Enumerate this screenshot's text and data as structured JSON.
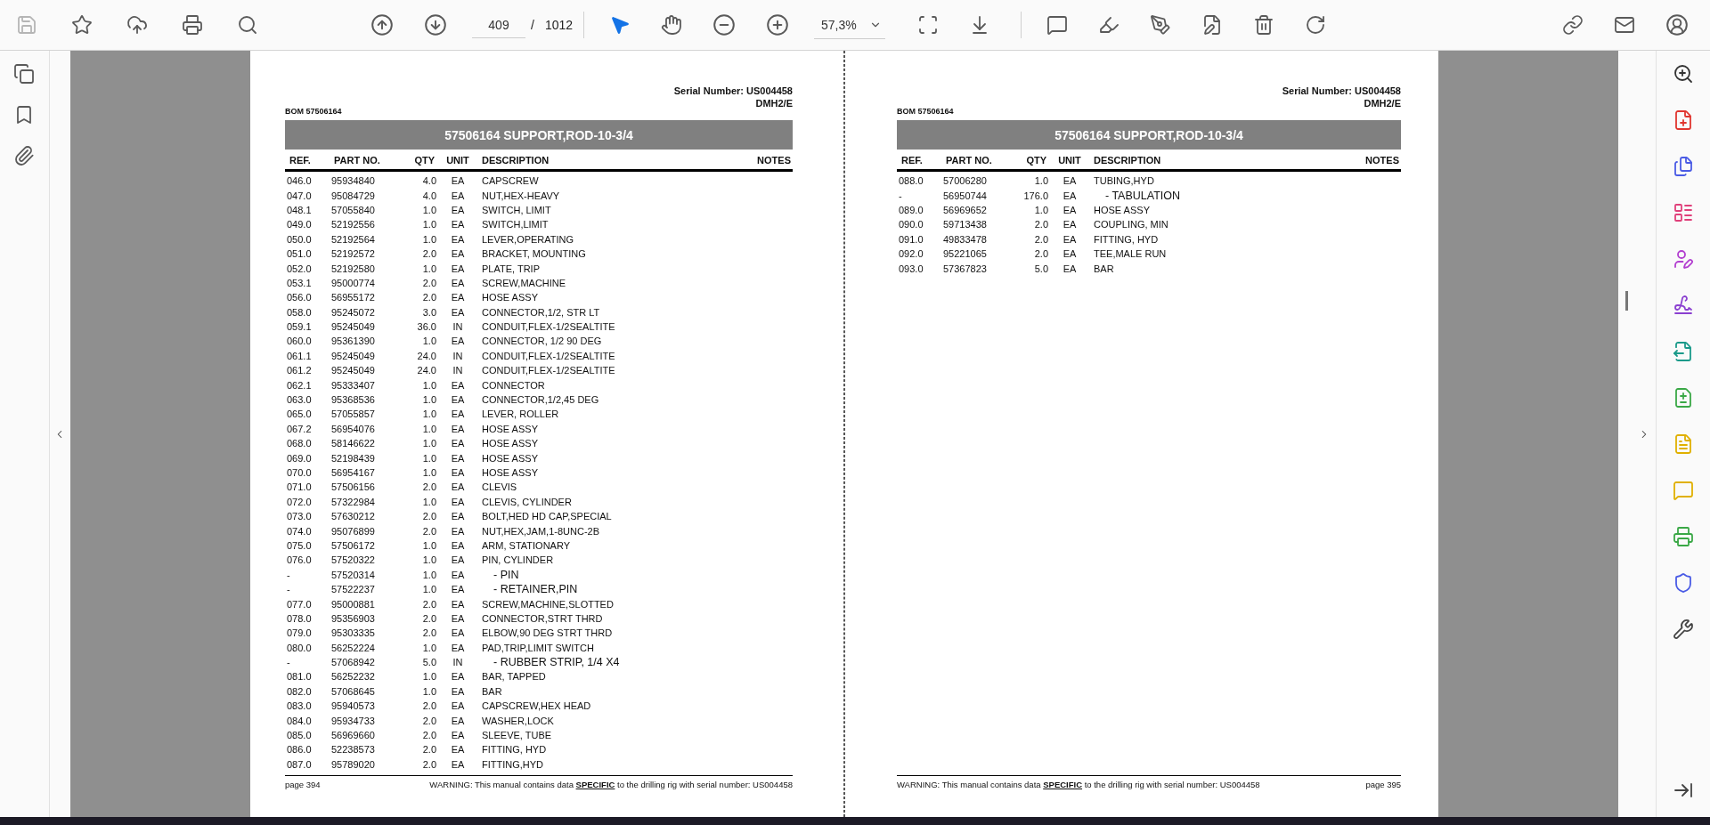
{
  "toolbar": {
    "page_current": "409",
    "page_separator": "/",
    "page_total": "1012",
    "zoom": "57,3%",
    "pointer_tools": [
      {
        "kind": "select",
        "selected": true
      },
      {
        "kind": "hand",
        "selected": false
      }
    ]
  },
  "pages": [
    {
      "kind": "left",
      "serial": "Serial Number: US004458",
      "model": "DMH2/E",
      "bom": "BOM 57506164",
      "title": "57506164 SUPPORT,ROD-10-3/4",
      "columns": [
        "REF.",
        "PART NO.",
        "QTY",
        "UNIT",
        "DESCRIPTION",
        "NOTES"
      ],
      "rows": [
        {
          "kind": "item",
          "ref": "046.0",
          "part": "95934840",
          "qty": "4.0",
          "unit": "EA",
          "desc": "CAPSCREW"
        },
        {
          "kind": "item",
          "ref": "047.0",
          "part": "95084729",
          "qty": "4.0",
          "unit": "EA",
          "desc": "NUT,HEX-HEAVY"
        },
        {
          "kind": "item",
          "ref": "048.1",
          "part": "57055840",
          "qty": "1.0",
          "unit": "EA",
          "desc": "SWITCH, LIMIT"
        },
        {
          "kind": "item",
          "ref": "049.0",
          "part": "52192556",
          "qty": "1.0",
          "unit": "EA",
          "desc": "SWITCH,LIMIT"
        },
        {
          "kind": "item",
          "ref": "050.0",
          "part": "52192564",
          "qty": "1.0",
          "unit": "EA",
          "desc": "LEVER,OPERATING"
        },
        {
          "kind": "item",
          "ref": "051.0",
          "part": "52192572",
          "qty": "2.0",
          "unit": "EA",
          "desc": "BRACKET, MOUNTING"
        },
        {
          "kind": "item",
          "ref": "052.0",
          "part": "52192580",
          "qty": "1.0",
          "unit": "EA",
          "desc": "PLATE, TRIP"
        },
        {
          "kind": "item",
          "ref": "053.1",
          "part": "95000774",
          "qty": "2.0",
          "unit": "EA",
          "desc": "SCREW,MACHINE"
        },
        {
          "kind": "item",
          "ref": "056.0",
          "part": "56955172",
          "qty": "2.0",
          "unit": "EA",
          "desc": "HOSE ASSY"
        },
        {
          "kind": "item",
          "ref": "058.0",
          "part": "95245072",
          "qty": "3.0",
          "unit": "EA",
          "desc": "CONNECTOR,1/2, STR LT"
        },
        {
          "kind": "item",
          "ref": "059.1",
          "part": "95245049",
          "qty": "36.0",
          "unit": "IN",
          "desc": "CONDUIT,FLEX-1/2SEALTITE"
        },
        {
          "kind": "item",
          "ref": "060.0",
          "part": "95361390",
          "qty": "1.0",
          "unit": "EA",
          "desc": "CONNECTOR, 1/2 90 DEG"
        },
        {
          "kind": "item",
          "ref": "061.1",
          "part": "95245049",
          "qty": "24.0",
          "unit": "IN",
          "desc": "CONDUIT,FLEX-1/2SEALTITE"
        },
        {
          "kind": "item",
          "ref": "061.2",
          "part": "95245049",
          "qty": "24.0",
          "unit": "IN",
          "desc": "CONDUIT,FLEX-1/2SEALTITE"
        },
        {
          "kind": "item",
          "ref": "062.1",
          "part": "95333407",
          "qty": "1.0",
          "unit": "EA",
          "desc": "CONNECTOR"
        },
        {
          "kind": "item",
          "ref": "063.0",
          "part": "95368536",
          "qty": "1.0",
          "unit": "EA",
          "desc": "CONNECTOR,1/2,45 DEG"
        },
        {
          "kind": "item",
          "ref": "065.0",
          "part": "57055857",
          "qty": "1.0",
          "unit": "EA",
          "desc": "LEVER, ROLLER"
        },
        {
          "kind": "item",
          "ref": "067.2",
          "part": "56954076",
          "qty": "1.0",
          "unit": "EA",
          "desc": "HOSE ASSY"
        },
        {
          "kind": "item",
          "ref": "068.0",
          "part": "58146622",
          "qty": "1.0",
          "unit": "EA",
          "desc": "HOSE ASSY"
        },
        {
          "kind": "item",
          "ref": "069.0",
          "part": "52198439",
          "qty": "1.0",
          "unit": "EA",
          "desc": "HOSE ASSY"
        },
        {
          "kind": "item",
          "ref": "070.0",
          "part": "56954167",
          "qty": "1.0",
          "unit": "EA",
          "desc": "HOSE ASSY"
        },
        {
          "kind": "item",
          "ref": "071.0",
          "part": "57506156",
          "qty": "2.0",
          "unit": "EA",
          "desc": "CLEVIS"
        },
        {
          "kind": "item",
          "ref": "072.0",
          "part": "57322984",
          "qty": "1.0",
          "unit": "EA",
          "desc": "CLEVIS, CYLINDER"
        },
        {
          "kind": "item",
          "ref": "073.0",
          "part": "57630212",
          "qty": "2.0",
          "unit": "EA",
          "desc": "BOLT,HED HD CAP,SPECIAL"
        },
        {
          "kind": "item",
          "ref": "074.0",
          "part": "95076899",
          "qty": "2.0",
          "unit": "EA",
          "desc": "NUT,HEX,JAM,1-8UNC-2B"
        },
        {
          "kind": "item",
          "ref": "075.0",
          "part": "57506172",
          "qty": "1.0",
          "unit": "EA",
          "desc": "ARM, STATIONARY"
        },
        {
          "kind": "item",
          "ref": "076.0",
          "part": "57520322",
          "qty": "1.0",
          "unit": "EA",
          "desc": "PIN, CYLINDER"
        },
        {
          "kind": "sub",
          "ref": "-",
          "part": "57520314",
          "qty": "1.0",
          "unit": "EA",
          "desc": "- PIN"
        },
        {
          "kind": "sub",
          "ref": "-",
          "part": "57522237",
          "qty": "1.0",
          "unit": "EA",
          "desc": "- RETAINER,PIN"
        },
        {
          "kind": "item",
          "ref": "077.0",
          "part": "95000881",
          "qty": "2.0",
          "unit": "EA",
          "desc": "SCREW,MACHINE,SLOTTED"
        },
        {
          "kind": "item",
          "ref": "078.0",
          "part": "95356903",
          "qty": "2.0",
          "unit": "EA",
          "desc": "CONNECTOR,STRT THRD"
        },
        {
          "kind": "item",
          "ref": "079.0",
          "part": "95303335",
          "qty": "2.0",
          "unit": "EA",
          "desc": "ELBOW,90 DEG STRT THRD"
        },
        {
          "kind": "item",
          "ref": "080.0",
          "part": "56252224",
          "qty": "1.0",
          "unit": "EA",
          "desc": "PAD,TRIP,LIMIT SWITCH"
        },
        {
          "kind": "sub",
          "ref": "-",
          "part": "57068942",
          "qty": "5.0",
          "unit": "IN",
          "desc": "- RUBBER STRIP, 1/4 X4"
        },
        {
          "kind": "item",
          "ref": "081.0",
          "part": "56252232",
          "qty": "1.0",
          "unit": "EA",
          "desc": "BAR, TAPPED"
        },
        {
          "kind": "item",
          "ref": "082.0",
          "part": "57068645",
          "qty": "1.0",
          "unit": "EA",
          "desc": "BAR"
        },
        {
          "kind": "item",
          "ref": "083.0",
          "part": "95940573",
          "qty": "2.0",
          "unit": "EA",
          "desc": "CAPSCREW,HEX HEAD"
        },
        {
          "kind": "item",
          "ref": "084.0",
          "part": "95934733",
          "qty": "2.0",
          "unit": "EA",
          "desc": "WASHER,LOCK"
        },
        {
          "kind": "item",
          "ref": "085.0",
          "part": "56969660",
          "qty": "2.0",
          "unit": "EA",
          "desc": "SLEEVE, TUBE"
        },
        {
          "kind": "item",
          "ref": "086.0",
          "part": "52238573",
          "qty": "2.0",
          "unit": "EA",
          "desc": "FITTING, HYD"
        },
        {
          "kind": "item",
          "ref": "087.0",
          "part": "95789020",
          "qty": "2.0",
          "unit": "EA",
          "desc": "FITTING,HYD"
        }
      ],
      "page_number": "page 394",
      "warning": "WARNING:  This manual contains data **SPECIFIC** to the drilling rig with serial number: US004458"
    },
    {
      "kind": "right",
      "serial": "Serial Number: US004458",
      "model": "DMH2/E",
      "bom": "BOM 57506164",
      "title": "57506164 SUPPORT,ROD-10-3/4",
      "columns": [
        "REF.",
        "PART NO.",
        "QTY",
        "UNIT",
        "DESCRIPTION",
        "NOTES"
      ],
      "rows": [
        {
          "kind": "item",
          "ref": "088.0",
          "part": "57006280",
          "qty": "1.0",
          "unit": "EA",
          "desc": "TUBING,HYD"
        },
        {
          "kind": "sub",
          "ref": "-",
          "part": "56950744",
          "qty": "176.0",
          "unit": "EA",
          "desc": "- TABULATION"
        },
        {
          "kind": "item",
          "ref": "089.0",
          "part": "56969652",
          "qty": "1.0",
          "unit": "EA",
          "desc": "HOSE ASSY"
        },
        {
          "kind": "item",
          "ref": "090.0",
          "part": "59713438",
          "qty": "2.0",
          "unit": "EA",
          "desc": "COUPLING, MIN"
        },
        {
          "kind": "item",
          "ref": "091.0",
          "part": "49833478",
          "qty": "2.0",
          "unit": "EA",
          "desc": "FITTING, HYD"
        },
        {
          "kind": "item",
          "ref": "092.0",
          "part": "95221065",
          "qty": "2.0",
          "unit": "EA",
          "desc": "TEE,MALE RUN"
        },
        {
          "kind": "item",
          "ref": "093.0",
          "part": "57367823",
          "qty": "5.0",
          "unit": "EA",
          "desc": "BAR"
        }
      ],
      "page_number": "page 395",
      "warning": "WARNING:  This manual contains data **SPECIFIC** to the drilling rig with serial number: US004458"
    }
  ]
}
